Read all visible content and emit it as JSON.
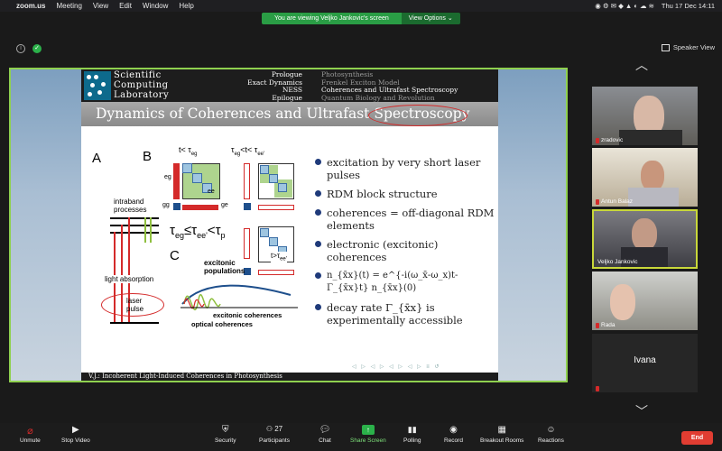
{
  "menubar": {
    "app": "zoom.us",
    "items": [
      "Meeting",
      "View",
      "Edit",
      "Window",
      "Help"
    ],
    "datetime": "Thu 17 Dec  14:11"
  },
  "share_banner": {
    "text": "You are viewing Veljko Jankovic's screen",
    "options": "View Options"
  },
  "speaker_view": "Speaker View",
  "slide": {
    "logo_line1": "Scientific",
    "logo_line2": "Computing",
    "logo_line3": "Laboratory",
    "nav_left": [
      "Prologue",
      "Exact Dynamics",
      "NESS",
      "Epilogue"
    ],
    "nav_right": [
      "Photosynthesis",
      "Frenkel Exciton Model",
      "Coherences and Ultrafast Spectroscopy",
      "Quantum Biology and Revolution"
    ],
    "title": "Dynamics of Coherences and Ultrafast Spectroscopy",
    "bullets": [
      "excitation by very short laser pulses",
      "RDM block structure",
      "coherences = off-diagonal RDM elements",
      "electronic (excitonic) coherences",
      "n_{x̄x}(t) = e^{-i(ω_x̄-ω_x)t-Γ_{x̄x}t} n_{x̄x}(0)",
      "decay rate Γ_{x̄x} is experimentally accessible"
    ],
    "footer": "V.J.: Incoherent Light-Induced Coherences in Photosynthesis",
    "figure": {
      "label_A": "A",
      "label_B": "B",
      "label_C": "C",
      "intraband": "intraband",
      "processes": "processes",
      "light_absorption": "light absorption",
      "laser": "laser",
      "pulse": "pulse",
      "t_lt_teg": "t< τ",
      "t_lt_teg_sub": "eg",
      "teg_lt_tee": "τ",
      "teg_lt_tee_mid": "eg",
      "teg_lt_tee_2": "<t< τ",
      "teg_lt_tee_sub": "ee'",
      "eg": "eg",
      "ee": "ee",
      "gg": "gg",
      "ge": "ge",
      "big_relation": "τ",
      "big_eg": "eg",
      "big_le": "≤τ",
      "big_ee": "ee'",
      "big_lt": "<τ",
      "big_p": "p",
      "t_gt_tee": "t>",
      "t_gt_tee_2": "τ",
      "t_gt_tee_sub": "ee'",
      "excitonic_populations_1": "excitonic",
      "excitonic_populations_2": "populations",
      "excitonic_coherences": "excitonic coherences",
      "optical_coherences": "optical coherences"
    }
  },
  "participants": [
    {
      "name": "zradovic",
      "muted": true
    },
    {
      "name": "Antun Balaz",
      "muted": false
    },
    {
      "name": "Veljko Jankovic",
      "muted": false,
      "active": true
    },
    {
      "name": "Rada",
      "muted": true
    },
    {
      "name": "Ivana",
      "muted": true
    }
  ],
  "toolbar": {
    "unmute": "Unmute",
    "stop_video": "Stop Video",
    "security": "Security",
    "participants": "Participants",
    "participants_count": "27",
    "chat": "Chat",
    "share_screen": "Share Screen",
    "polling": "Polling",
    "record": "Record",
    "breakout": "Breakout Rooms",
    "reactions": "Reactions",
    "end": "End"
  }
}
